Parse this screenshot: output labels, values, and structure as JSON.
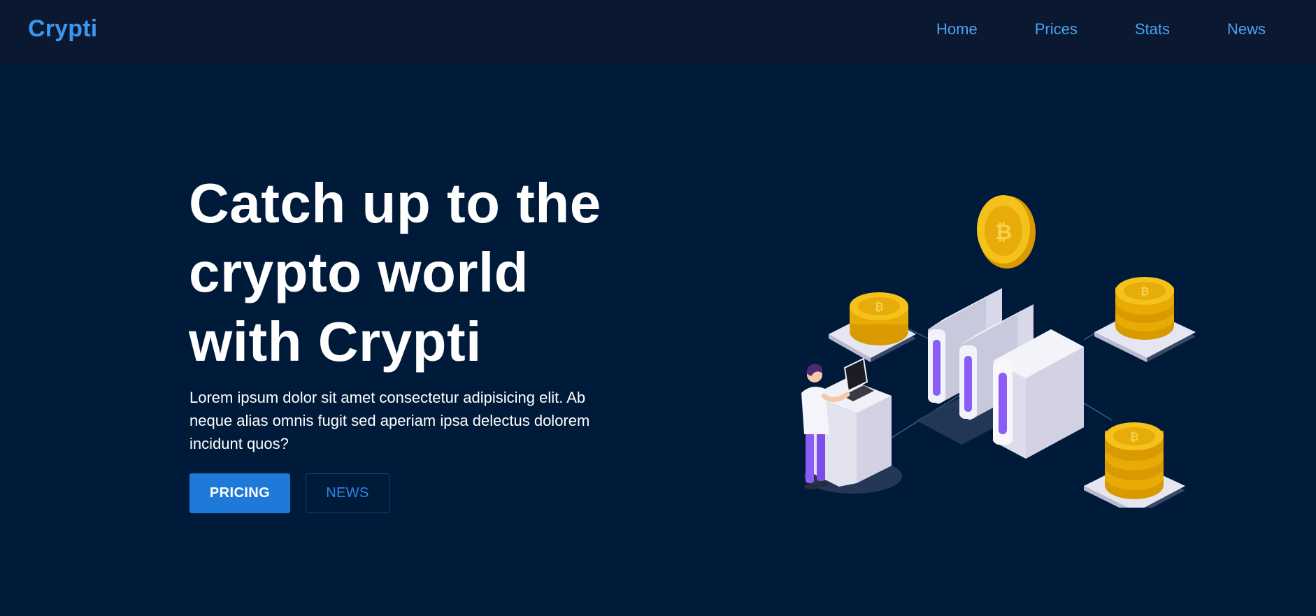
{
  "brand": {
    "name": "Crypti"
  },
  "nav": {
    "items": [
      {
        "label": "Home"
      },
      {
        "label": "Prices"
      },
      {
        "label": "Stats"
      },
      {
        "label": "News"
      }
    ]
  },
  "hero": {
    "headline": "Catch up to the crypto world with Crypti",
    "description": "Lorem ipsum dolor sit amet consectetur adipisicing elit. Ab neque alias omnis fugit sed aperiam ipsa delectus dolorem incidunt quos?",
    "primary_button": "PRICING",
    "secondary_button": "NEWS"
  },
  "colors": {
    "nav_background": "#0a1831",
    "page_background": "#001b3a",
    "brand": "#3c97f1",
    "accent": "#1e79d8",
    "coin": "#f0b90b",
    "server_light": "#e4e4f0",
    "server_glow": "#8b5cf6"
  },
  "icons": {
    "illustration": "isometric-crypto-server-illustration",
    "coin": "bitcoin-coin-icon"
  }
}
